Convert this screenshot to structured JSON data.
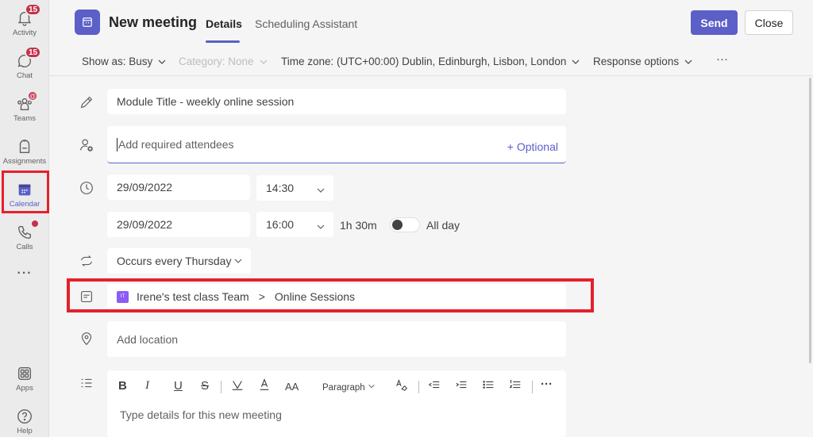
{
  "rail": {
    "activity": {
      "label": "Activity",
      "badge": "15"
    },
    "chat": {
      "label": "Chat",
      "badge": "15"
    },
    "teams": {
      "label": "Teams",
      "badge": "@"
    },
    "assignments": {
      "label": "Assignments"
    },
    "calendar": {
      "label": "Calendar"
    },
    "calls": {
      "label": "Calls"
    },
    "more": "···",
    "apps": {
      "label": "Apps"
    },
    "help": {
      "label": "Help"
    }
  },
  "header": {
    "title": "New meeting",
    "tabs": [
      "Details",
      "Scheduling Assistant"
    ],
    "send_label": "Send",
    "close_label": "Close"
  },
  "options": {
    "show_as": "Show as: Busy",
    "category": "Category: None",
    "time_zone": "Time zone: (UTC+00:00) Dublin, Edinburgh, Lisbon, London",
    "response_options": "Response options",
    "more": "···"
  },
  "form": {
    "title_value": "Module Title - weekly online session",
    "attendees_placeholder": "Add required attendees",
    "optional_label": "+ Optional",
    "start_date": "29/09/2022",
    "start_time": "14:30",
    "end_date": "29/09/2022",
    "end_time": "16:00",
    "duration": "1h 30m",
    "all_day_label": "All day",
    "all_day_on": false,
    "recurrence": "Occurs every Thursday",
    "team_chip": "IT",
    "team_name": "Irene's test class Team",
    "channel_separator": ">",
    "channel_name": "Online Sessions",
    "location_placeholder": "Add location",
    "editor": {
      "bold": "B",
      "italic": "I",
      "underline": "U",
      "strike": "S",
      "font_size": "AA",
      "paragraph": "Paragraph",
      "more": "···",
      "placeholder": "Type details for this new meeting"
    }
  },
  "colors": {
    "accent": "#5b5fc7",
    "badge": "#c4314b",
    "highlight_box": "#e5202c"
  }
}
